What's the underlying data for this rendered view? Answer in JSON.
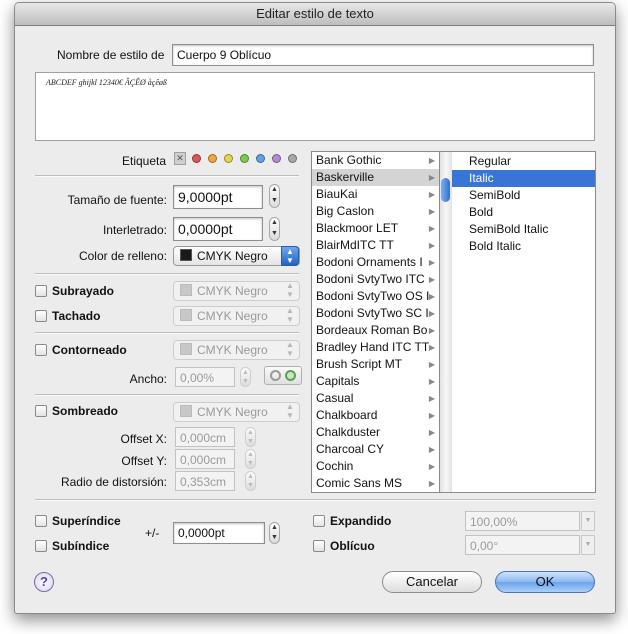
{
  "title": "Editar estilo de texto",
  "style_name": {
    "label": "Nombre de estilo de",
    "value": "Cuerpo 9 Oblícuo"
  },
  "preview_text": "ABCDEF ghijkl 12340€ ÂÇÊØ åçêøß",
  "etiqueta": {
    "label": "Etiqueta",
    "none_glyph": "✕",
    "colors": [
      "#e05353",
      "#f0a540",
      "#e6d64a",
      "#7ccb4d",
      "#5da2e8",
      "#b887d6",
      "#a8a8a8"
    ]
  },
  "font_size": {
    "label": "Tamaño de fuente:",
    "value": "9,0000pt"
  },
  "tracking": {
    "label": "Interletrado:",
    "value": "0,0000pt"
  },
  "fill": {
    "label": "Color de relleno:",
    "value": "CMYK Negro"
  },
  "underline": {
    "label": "Subrayado",
    "color": "CMYK Negro"
  },
  "strike": {
    "label": "Tachado",
    "color": "CMYK Negro"
  },
  "outline": {
    "label": "Contorneado",
    "color": "CMYK Negro",
    "width_label": "Ancho:",
    "width_value": "0,00%"
  },
  "shadow": {
    "label": "Sombreado",
    "color": "CMYK Negro",
    "offset_x_label": "Offset X:",
    "offset_x": "0,000cm",
    "offset_y_label": "Offset Y:",
    "offset_y": "0,000cm",
    "blur_label": "Radio de distorsión:",
    "blur": "0,353cm"
  },
  "fonts": [
    "Bank Gothic",
    "Baskerville",
    "BiauKai",
    "Big Caslon",
    "Blackmoor LET",
    "BlairMdITC TT",
    "Bodoni Ornaments I",
    "Bodoni SvtyTwo ITC",
    "Bodoni SvtyTwo OS I",
    "Bodoni SvtyTwo SC I",
    "Bordeaux Roman Bo",
    "Bradley Hand ITC TT",
    "Brush Script MT",
    "Capitals",
    "Casual",
    "Chalkboard",
    "Chalkduster",
    "Charcoal CY",
    "Cochin",
    "Comic Sans MS"
  ],
  "selected_font": "Baskerville",
  "faces": [
    "Regular",
    "Italic",
    "SemiBold",
    "Bold",
    "SemiBold Italic",
    "Bold Italic"
  ],
  "selected_face": "Italic",
  "superscript": {
    "label": "Superíndice"
  },
  "subscript": {
    "label": "Subíndice"
  },
  "baseline": {
    "label": "+/-",
    "value": "0,0000pt"
  },
  "expanded": {
    "label": "Expandido",
    "value": "100,00%"
  },
  "oblique": {
    "label": "Oblícuo",
    "value": "0,00°"
  },
  "help_glyph": "?",
  "cancel_label": "Cancelar",
  "ok_label": "OK"
}
